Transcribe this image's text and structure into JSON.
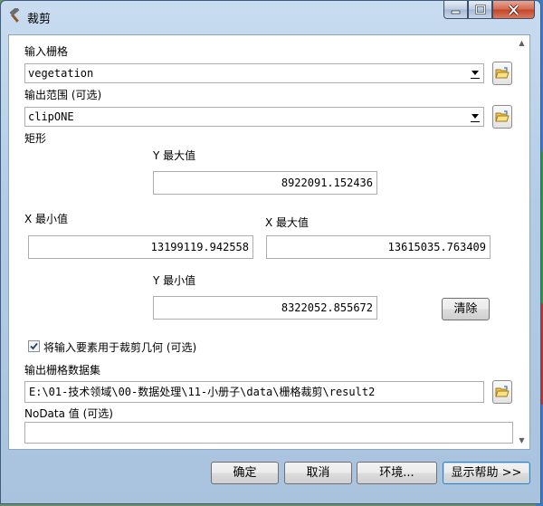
{
  "window": {
    "title": "裁剪"
  },
  "input_raster": {
    "label": "输入栅格",
    "value": "vegetation"
  },
  "output_extent": {
    "label": "输出范围 (可选)",
    "value": "clipONE"
  },
  "rectangle": {
    "label": "矩形",
    "y_max": {
      "label": "Y 最大值",
      "value": "8922091.152436"
    },
    "x_min": {
      "label": "X 最小值",
      "value": "13199119.942558"
    },
    "x_max": {
      "label": "X 最大值",
      "value": "13615035.763409"
    },
    "y_min": {
      "label": "Y 最小值",
      "value": "8322052.855672"
    },
    "clear_label": "清除"
  },
  "use_features": {
    "label": "将输入要素用于裁剪几何 (可选)",
    "checked": true
  },
  "output_raster": {
    "label": "输出栅格数据集",
    "value": "E:\\01-技术领域\\00-数据处理\\11-小册子\\data\\栅格裁剪\\result2"
  },
  "nodata": {
    "label": "NoData 值 (可选)",
    "value": ""
  },
  "footer": {
    "ok_label": "确定",
    "cancel_label": "取消",
    "env_label": "环境...",
    "help_label": "显示帮助 >>"
  }
}
